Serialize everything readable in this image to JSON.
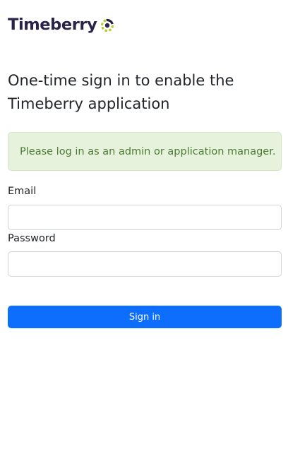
{
  "brand": {
    "name": "Timeberry",
    "logo_icon": "timeberry-ring-icon",
    "colors": {
      "text": "#2a2248",
      "ring_dark": "#2a2248",
      "ring_accent": "#b4cc26"
    }
  },
  "heading": "One-time sign in to enable the Timeberry application",
  "alert": {
    "message": "Please log in as an admin or application manager.",
    "color": "#4b7b33",
    "background": "#e6f2dc"
  },
  "form": {
    "email": {
      "label": "Email",
      "value": "",
      "placeholder": ""
    },
    "password": {
      "label": "Password",
      "value": "",
      "placeholder": ""
    },
    "submit_label": "Sign in",
    "submit_color": "#0d6efd"
  }
}
